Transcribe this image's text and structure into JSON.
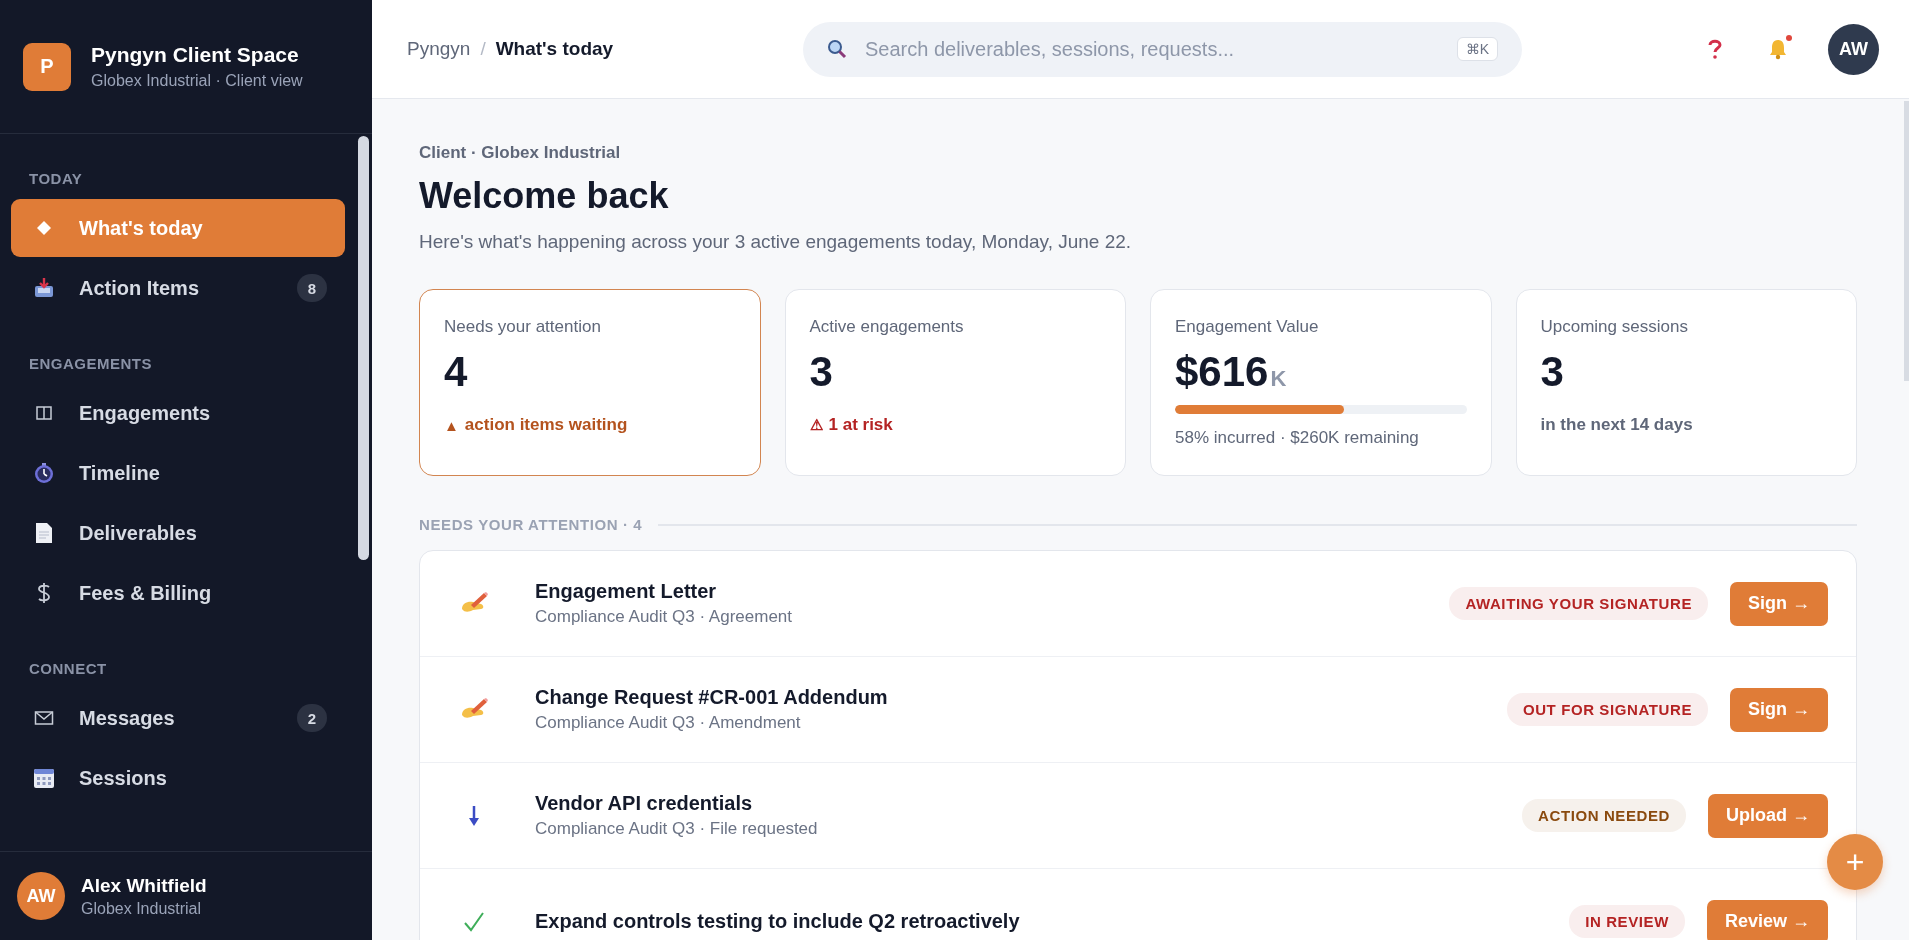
{
  "sidebar": {
    "brand": {
      "logo_letter": "P",
      "title": "Pyngyn Client Space",
      "subtitle": "Globex Industrial · Client view"
    },
    "sections": [
      {
        "label": "TODAY",
        "items": [
          {
            "label": "What's today",
            "selected": true
          },
          {
            "label": "Action Items",
            "badge": "8",
            "selected": false
          }
        ]
      },
      {
        "label": "ENGAGEMENTS",
        "items": [
          {
            "label": "Engagements",
            "selected": false
          },
          {
            "label": "Timeline",
            "selected": false
          },
          {
            "label": "Deliverables",
            "selected": false
          },
          {
            "label": "Fees & Billing",
            "selected": false
          }
        ]
      },
      {
        "label": "CONNECT",
        "items": [
          {
            "label": "Messages",
            "badge": "2",
            "selected": false
          },
          {
            "label": "Sessions",
            "selected": false
          }
        ]
      }
    ],
    "user": {
      "initials": "AW",
      "name": "Alex Whitfield",
      "org": "Globex Industrial"
    }
  },
  "header": {
    "breadcrumb": [
      {
        "label": "Pyngyn",
        "current": false
      },
      {
        "label": "What's today",
        "current": true
      }
    ],
    "breadcrumb_separator": "/",
    "search": {
      "placeholder": "Search deliverables, sessions, requests...",
      "shortcut": "⌘K"
    },
    "notifications_unread": true,
    "avatar_initials": "AW"
  },
  "page": {
    "eyebrow": "Client · Globex Industrial",
    "title": "Welcome back",
    "subtitle": "Here's what's happening across your 3 active engagements today, Monday, June 22."
  },
  "stats": [
    {
      "kind": "count",
      "label": "Needs your attention",
      "value": "4",
      "note_icon": "▲",
      "note": "action items waiting",
      "color": "#b4531e",
      "highlighted": true
    },
    {
      "kind": "count",
      "label": "Active engagements",
      "value": "3",
      "note_icon": "⚠",
      "note": "1 at risk",
      "color": "#b42323",
      "highlighted": false
    },
    {
      "kind": "progress",
      "label": "Engagement Value",
      "value": "$616",
      "unit": "K",
      "level": 0.58,
      "note": "58% incurred · $260K remaining",
      "color": "#5f6779",
      "highlighted": false
    },
    {
      "kind": "count",
      "label": "Upcoming sessions",
      "value": "3",
      "note": "in the next 14 days",
      "color": "#5f6779",
      "highlighted": false
    }
  ],
  "attention": {
    "heading": "NEEDS YOUR ATTENTION · 4",
    "items": [
      {
        "title": "Engagement Letter",
        "subtitle": "Compliance Audit Q3 · Agreement",
        "status": "AWAITING YOUR SIGNATURE",
        "color": "#b42323",
        "action": "Sign →"
      },
      {
        "title": "Change Request #CR-001 Addendum",
        "subtitle": "Compliance Audit Q3 · Amendment",
        "status": "OUT FOR SIGNATURE",
        "color": "#b42323",
        "action": "Sign →"
      },
      {
        "title": "Vendor API credentials",
        "subtitle": "Compliance Audit Q3 · File requested",
        "status": "ACTION NEEDED",
        "color": "#8a4a0e",
        "action": "Upload →"
      },
      {
        "title": "Expand controls testing to include Q2 retroactively",
        "status": "IN REVIEW",
        "color": "#b42323",
        "action": "Review →"
      }
    ]
  },
  "fab": {
    "symbol": "+"
  }
}
